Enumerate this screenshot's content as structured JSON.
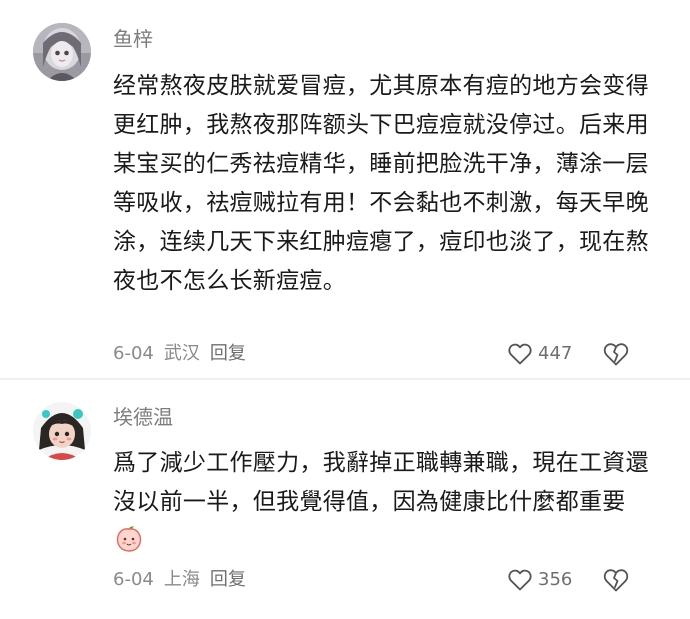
{
  "comments": [
    {
      "username": "鱼梓",
      "text": "经常熬夜皮肤就爱冒痘，尤其原本有痘的地方会变得更红肿，我熬夜那阵额头下巴痘痘就没停过。后来用某宝买的仁秀祛痘精华，睡前把脸洗干净，薄涂一层等吸收，祛痘贼拉有用！不会黏也不刺激，每天早晚涂，连续几天下来红肿痘瘪了，痘印也淡了，现在熬夜也不怎么长新痘痘。",
      "date": "6-04",
      "location": "武汉",
      "reply_label": "回复",
      "likes": "447",
      "avatar_icon": "anime-girl-avatar"
    },
    {
      "username": "埃德温",
      "text": "爲了減少工作壓力，我辭掉正職轉兼職，現在工資還沒以前一半，但我覺得值，因為健康比什麼都重要",
      "emoji": "peach-emoji-icon",
      "date": "6-04",
      "location": "上海",
      "reply_label": "回复",
      "likes": "356",
      "avatar_icon": "cartoon-girl-avatar"
    }
  ],
  "colors": {
    "text": "#1a1a1a",
    "muted": "#8a8a8a",
    "divider": "#efefef"
  }
}
